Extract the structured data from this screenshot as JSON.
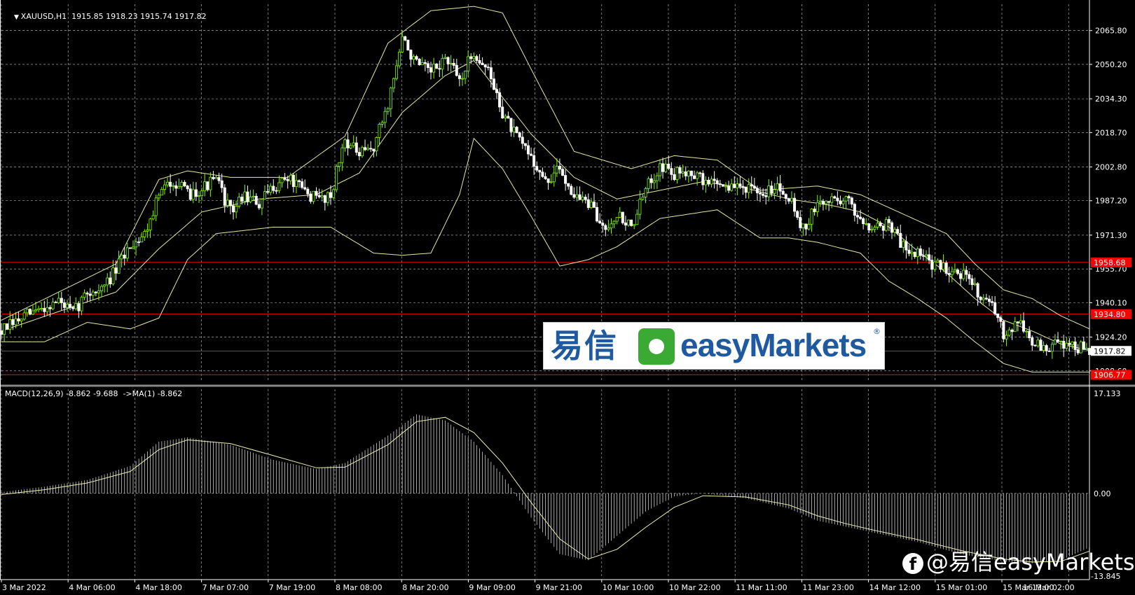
{
  "header": {
    "symbol_line": "XAUUSD,H1  1915.85 1918.23 1915.74 1917.82",
    "macd_line": "MACD(12,26,9) -8.862 -9.688  ->MA(1) -8.862"
  },
  "colors": {
    "background": "#000000",
    "grid": "#c8c8c8",
    "bull": "#7CFC00",
    "bear": "#ffffff",
    "band": "#e8e8a0",
    "level": "#ff0000",
    "macd_hist": "#d0d0d0",
    "signal": "#f0f0b0"
  },
  "x_labels": [
    "3 Mar 2022",
    "4 Mar 06:00",
    "4 Mar 18:00",
    "7 Mar 07:00",
    "7 Mar 19:00",
    "8 Mar 08:00",
    "8 Mar 20:00",
    "9 Mar 09:00",
    "9 Mar 21:00",
    "10 Mar 10:00",
    "10 Mar 22:00",
    "11 Mar 11:00",
    "11 Mar 23:00",
    "14 Mar 12:00",
    "15 Mar 01:00",
    "15 Mar 13:00",
    "16 Mar 02:00"
  ],
  "price_ticks": [
    "2065.80",
    "2050.20",
    "2034.30",
    "2018.70",
    "2002.80",
    "1987.20",
    "1971.30",
    "1955.70",
    "1940.10",
    "1924.20",
    "1908.60"
  ],
  "macd_ticks": [
    "17.133",
    "0.00",
    "-13.845"
  ],
  "levels": [
    {
      "value": 1958.68,
      "label": "1958.68"
    },
    {
      "value": 1934.8,
      "label": "1934.80"
    },
    {
      "value": 1906.77,
      "label": "1906.77"
    }
  ],
  "current_price": {
    "value": 1917.82,
    "label": "1917.82"
  },
  "logo": {
    "cn": "易信",
    "en": "easyMarkets",
    "reg": "®"
  },
  "watermark": {
    "icon": "f",
    "text": "@易信easyMarkets"
  },
  "chart_data": [
    {
      "type": "candlestick",
      "title": "XAUUSD,H1",
      "ylim": [
        1904,
        2078
      ],
      "close_path": [
        [
          0,
          1927
        ],
        [
          10,
          1935
        ],
        [
          20,
          1941
        ],
        [
          25,
          1935
        ],
        [
          30,
          1945
        ],
        [
          35,
          1946
        ],
        [
          40,
          1955
        ],
        [
          45,
          1967
        ],
        [
          50,
          1972
        ],
        [
          55,
          1990
        ],
        [
          60,
          1997
        ],
        [
          65,
          1990
        ],
        [
          70,
          1993
        ],
        [
          75,
          1997
        ],
        [
          80,
          1982
        ],
        [
          85,
          1990
        ],
        [
          90,
          1985
        ],
        [
          95,
          1994
        ],
        [
          100,
          1998
        ],
        [
          105,
          1992
        ],
        [
          110,
          1988
        ],
        [
          115,
          1990
        ],
        [
          120,
          2016
        ],
        [
          125,
          2008
        ],
        [
          130,
          2012
        ],
        [
          135,
          2032
        ],
        [
          140,
          2062
        ],
        [
          145,
          2050
        ],
        [
          150,
          2046
        ],
        [
          155,
          2053
        ],
        [
          160,
          2043
        ],
        [
          165,
          2056
        ],
        [
          170,
          2047
        ],
        [
          175,
          2028
        ],
        [
          180,
          2016
        ],
        [
          185,
          2008
        ],
        [
          190,
          1995
        ],
        [
          195,
          2002
        ],
        [
          200,
          1990
        ],
        [
          205,
          1986
        ],
        [
          210,
          1975
        ],
        [
          215,
          1981
        ],
        [
          220,
          1975
        ],
        [
          225,
          1992
        ],
        [
          230,
          2004
        ],
        [
          235,
          1999
        ],
        [
          240,
          2002
        ],
        [
          245,
          1996
        ],
        [
          250,
          1996
        ],
        [
          255,
          1993
        ],
        [
          260,
          1994
        ],
        [
          265,
          1988
        ],
        [
          270,
          1995
        ],
        [
          275,
          1990
        ],
        [
          280,
          1974
        ],
        [
          285,
          1985
        ],
        [
          290,
          1988
        ],
        [
          295,
          1988
        ],
        [
          300,
          1979
        ],
        [
          305,
          1975
        ],
        [
          310,
          1977
        ],
        [
          315,
          1966
        ],
        [
          320,
          1963
        ],
        [
          325,
          1958
        ],
        [
          330,
          1956
        ],
        [
          335,
          1954
        ],
        [
          340,
          1947
        ],
        [
          345,
          1940
        ],
        [
          350,
          1926
        ],
        [
          355,
          1932
        ],
        [
          360,
          1922
        ],
        [
          365,
          1918
        ],
        [
          370,
          1922
        ],
        [
          375,
          1920
        ],
        [
          380,
          1918
        ]
      ],
      "series": [
        {
          "name": "Upper band",
          "values": [
            [
              0,
              1932
            ],
            [
              20,
              1945
            ],
            [
              40,
              1958
            ],
            [
              55,
              1997
            ],
            [
              65,
              2001
            ],
            [
              80,
              1998
            ],
            [
              100,
              1998
            ],
            [
              120,
              2017
            ],
            [
              135,
              2060
            ],
            [
              150,
              2075
            ],
            [
              165,
              2077
            ],
            [
              175,
              2074
            ],
            [
              185,
              2048
            ],
            [
              200,
              2010
            ],
            [
              220,
              2002
            ],
            [
              235,
              2008
            ],
            [
              250,
              2006
            ],
            [
              265,
              1992
            ],
            [
              285,
              1994
            ],
            [
              300,
              1990
            ],
            [
              310,
              1984
            ],
            [
              320,
              1978
            ],
            [
              330,
              1972
            ],
            [
              340,
              1958
            ],
            [
              350,
              1946
            ],
            [
              360,
              1942
            ],
            [
              370,
              1934
            ],
            [
              380,
              1928
            ]
          ]
        },
        {
          "name": "Middle band",
          "values": [
            [
              0,
              1927
            ],
            [
              20,
              1936
            ],
            [
              40,
              1945
            ],
            [
              55,
              1965
            ],
            [
              70,
              1982
            ],
            [
              90,
              1988
            ],
            [
              110,
              1990
            ],
            [
              125,
              2000
            ],
            [
              140,
              2028
            ],
            [
              155,
              2045
            ],
            [
              165,
              2052
            ],
            [
              175,
              2035
            ],
            [
              185,
              2018
            ],
            [
              200,
              1998
            ],
            [
              215,
              1988
            ],
            [
              230,
              1992
            ],
            [
              245,
              1996
            ],
            [
              260,
              1993
            ],
            [
              275,
              1988
            ],
            [
              290,
              1985
            ],
            [
              300,
              1982
            ],
            [
              310,
              1975
            ],
            [
              320,
              1964
            ],
            [
              330,
              1954
            ],
            [
              340,
              1942
            ],
            [
              350,
              1932
            ],
            [
              360,
              1927
            ],
            [
              370,
              1921
            ],
            [
              380,
              1918
            ]
          ]
        },
        {
          "name": "Lower band",
          "values": [
            [
              0,
              1922
            ],
            [
              15,
              1922
            ],
            [
              30,
              1931
            ],
            [
              45,
              1928
            ],
            [
              55,
              1933
            ],
            [
              65,
              1960
            ],
            [
              75,
              1972
            ],
            [
              95,
              1975
            ],
            [
              115,
              1975
            ],
            [
              130,
              1963
            ],
            [
              140,
              1962
            ],
            [
              150,
              1963
            ],
            [
              160,
              1990
            ],
            [
              165,
              2016
            ],
            [
              175,
              2002
            ],
            [
              185,
              1980
            ],
            [
              195,
              1957
            ],
            [
              205,
              1960
            ],
            [
              215,
              1966
            ],
            [
              230,
              1979
            ],
            [
              250,
              1983
            ],
            [
              265,
              1970
            ],
            [
              275,
              1970
            ],
            [
              285,
              1968
            ],
            [
              300,
              1963
            ],
            [
              310,
              1950
            ],
            [
              320,
              1942
            ],
            [
              330,
              1933
            ],
            [
              340,
              1922
            ],
            [
              350,
              1912
            ],
            [
              360,
              1908
            ],
            [
              370,
              1908
            ],
            [
              380,
              1908
            ]
          ]
        }
      ]
    },
    {
      "type": "bar",
      "title": "MACD(12,26,9)",
      "ylim": [
        -13.845,
        17.133
      ],
      "macd_path": [
        [
          0,
          0.2
        ],
        [
          15,
          1.1
        ],
        [
          30,
          2.2
        ],
        [
          45,
          4.5
        ],
        [
          55,
          8.5
        ],
        [
          65,
          9.2
        ],
        [
          80,
          8
        ],
        [
          95,
          5.5
        ],
        [
          110,
          4
        ],
        [
          120,
          5
        ],
        [
          135,
          9.5
        ],
        [
          145,
          13
        ],
        [
          155,
          12
        ],
        [
          165,
          8.5
        ],
        [
          175,
          3
        ],
        [
          185,
          -4
        ],
        [
          195,
          -10
        ],
        [
          205,
          -11
        ],
        [
          215,
          -7
        ],
        [
          225,
          -3
        ],
        [
          235,
          -0.5
        ],
        [
          245,
          0
        ],
        [
          260,
          -0.8
        ],
        [
          275,
          -2.5
        ],
        [
          285,
          -4.5
        ],
        [
          295,
          -5.5
        ],
        [
          305,
          -6.5
        ],
        [
          320,
          -8
        ],
        [
          335,
          -10
        ],
        [
          350,
          -11.2
        ],
        [
          360,
          -11.5
        ],
        [
          370,
          -11
        ],
        [
          380,
          -8.9
        ]
      ],
      "series": [
        {
          "name": "MACD",
          "values": "macd_path"
        },
        {
          "name": "MA(1)",
          "values": [
            [
              0,
              -0.2
            ],
            [
              15,
              0.6
            ],
            [
              30,
              1.7
            ],
            [
              45,
              3.6
            ],
            [
              55,
              7.2
            ],
            [
              65,
              8.8
            ],
            [
              80,
              8.2
            ],
            [
              95,
              6.2
            ],
            [
              110,
              4.2
            ],
            [
              120,
              4.3
            ],
            [
              135,
              8.0
            ],
            [
              145,
              11.8
            ],
            [
              155,
              12.5
            ],
            [
              165,
              10.0
            ],
            [
              175,
              5.0
            ],
            [
              185,
              -1.5
            ],
            [
              195,
              -7.5
            ],
            [
              205,
              -10.8
            ],
            [
              215,
              -9.2
            ],
            [
              225,
              -5.6
            ],
            [
              235,
              -2.3
            ],
            [
              245,
              -0.4
            ],
            [
              260,
              -0.6
            ],
            [
              275,
              -1.9
            ],
            [
              285,
              -3.7
            ],
            [
              295,
              -5.0
            ],
            [
              305,
              -6.1
            ],
            [
              320,
              -7.6
            ],
            [
              335,
              -9.4
            ],
            [
              350,
              -10.8
            ],
            [
              360,
              -11.3
            ],
            [
              370,
              -11.2
            ],
            [
              380,
              -9.5
            ]
          ]
        }
      ]
    }
  ]
}
